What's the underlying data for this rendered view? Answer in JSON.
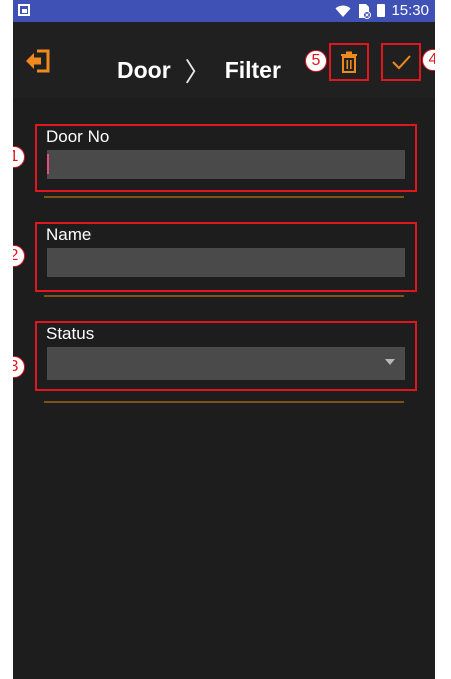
{
  "statusbar": {
    "time": "15:30",
    "icons": [
      "gallery-icon",
      "wifi-icon",
      "no-sim-icon",
      "battery-icon"
    ]
  },
  "toolbar": {
    "back_icon": "exit-icon",
    "crumb_root": "Door",
    "crumb_separator": "〉",
    "crumb_current": "Filter",
    "delete_icon": "trash-icon",
    "confirm_icon": "check-icon",
    "accent_color": "#f08a1e"
  },
  "form": {
    "door_no": {
      "label": "Door No",
      "value": "",
      "badge": "1"
    },
    "name": {
      "label": "Name",
      "value": "",
      "badge": "2"
    },
    "status": {
      "label": "Status",
      "selected": "",
      "badge": "3"
    }
  },
  "annotations": {
    "confirm_badge": "4",
    "delete_badge": "5",
    "color": "#e2161e"
  }
}
